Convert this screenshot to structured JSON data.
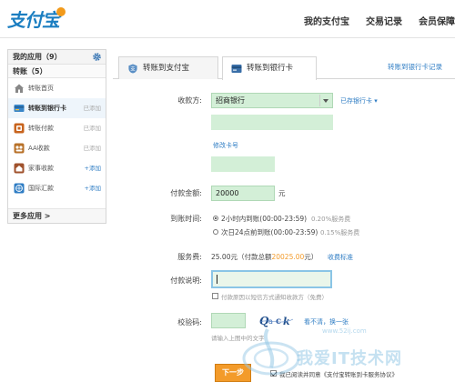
{
  "header": {
    "logo_text": "支付宝",
    "nav": [
      "我的支付宝",
      "交易记录",
      "会员保障"
    ]
  },
  "sidebar": {
    "my_apps": "我的应用（9）",
    "transfer_title": "转账（5）",
    "items": [
      {
        "label": "转账首页",
        "right": ""
      },
      {
        "label": "转账到银行卡",
        "right": "已添加"
      },
      {
        "label": "转账付款",
        "right": "已添加"
      },
      {
        "label": "AA收款",
        "right": "已添加"
      },
      {
        "label": "家事收款",
        "right": "+添加"
      },
      {
        "label": "国际汇款",
        "right": "+添加"
      }
    ],
    "more": "更多应用 >"
  },
  "tabs": {
    "alipay": "转账到支付宝",
    "bank": "转账到银行卡",
    "record": "转账到银行卡记录"
  },
  "form": {
    "payee_label": "收款方:",
    "bank_value": "招商银行",
    "saved_cards": "已存银行卡",
    "modify_card": "修改卡号",
    "amount_label": "付款金额:",
    "amount_value": "20000",
    "amount_unit": "元",
    "arrival_label": "到账时间:",
    "arrival_opt1": "2小时内到账(00:00-23:59)",
    "arrival_opt1_fee": "0.20%服务费",
    "arrival_opt2": "次日24点前到账(00:00-23:59)",
    "arrival_opt2_fee": "0.15%服务费",
    "fee_label": "服务费:",
    "fee_value_prefix": "25.00元（付款总额",
    "fee_total": "20025.00",
    "fee_value_suffix": "元）",
    "fee_standard": "收费标准",
    "note_label": "付款说明:",
    "note_check": "付款原因以短信方式通知收款方（免费）",
    "captcha_label": "校验码:",
    "captcha_refresh": "看不清，换一张",
    "captcha_hint": "请输入上图中的文字",
    "next_button": "下一步",
    "agree_text": "我已阅读并同意《支付宝转账到卡服务协议》"
  },
  "watermark": {
    "text": "我爱IT技术网",
    "sub": "www.52ij.com"
  },
  "colors": {
    "brand_blue": "#1b7ec1",
    "link_blue": "#2f7dc4",
    "button_orange": "#f39b2a",
    "field_green": "#d3efd7",
    "highlight_orange": "#f39b2a"
  }
}
